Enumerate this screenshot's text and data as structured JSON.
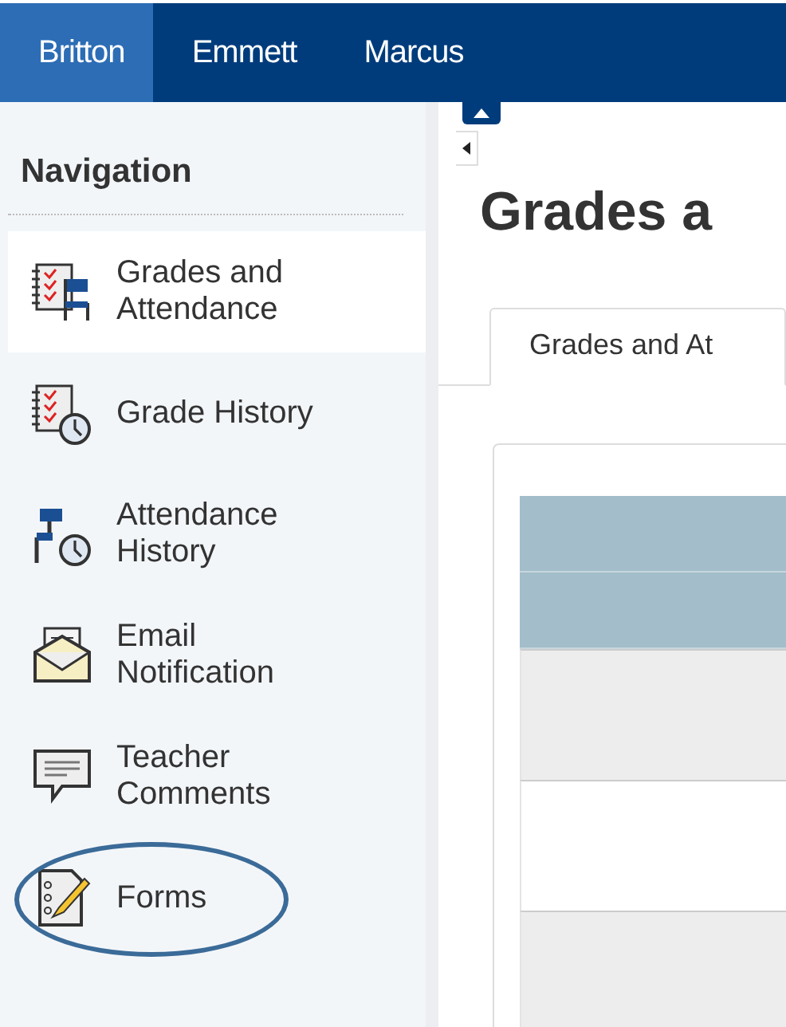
{
  "top_tabs": [
    {
      "label": "Britton",
      "selected": true
    },
    {
      "label": "Emmett",
      "selected": false
    },
    {
      "label": "Marcus",
      "selected": false
    }
  ],
  "sidebar": {
    "title": "Navigation",
    "items": [
      {
        "label": "Grades and Attendance",
        "selected": true
      },
      {
        "label": "Grade History",
        "selected": false
      },
      {
        "label": "Attendance History",
        "selected": false
      },
      {
        "label": "Email Notification",
        "selected": false
      },
      {
        "label": "Teacher Comments",
        "selected": false
      },
      {
        "label": "Forms",
        "selected": false,
        "circled": true
      }
    ]
  },
  "main": {
    "title": "Grades a",
    "tabs": [
      {
        "label": "Grades and At",
        "selected": true
      }
    ],
    "table": {
      "rows": [
        {
          "kind": "header"
        },
        {
          "kind": "header"
        },
        {
          "kind": "shaded"
        },
        {
          "kind": "plain"
        },
        {
          "kind": "shaded"
        }
      ]
    }
  }
}
